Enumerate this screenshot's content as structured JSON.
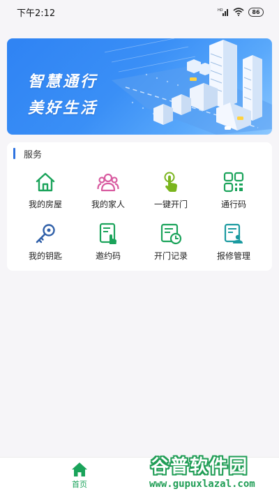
{
  "status_bar": {
    "time": "下午2:12",
    "battery": "86"
  },
  "banner": {
    "line1": "智慧通行",
    "line2": "美好生活"
  },
  "services": {
    "title": "服务",
    "items": [
      {
        "label": "我的房屋",
        "icon": "house-icon",
        "color": "#1aa35a"
      },
      {
        "label": "我的家人",
        "icon": "family-icon",
        "color": "#d85ba0"
      },
      {
        "label": "一键开门",
        "icon": "tap-icon",
        "color": "#7ab51d"
      },
      {
        "label": "通行码",
        "icon": "qr-code-icon",
        "color": "#1aa35a"
      },
      {
        "label": "我的钥匙",
        "icon": "key-icon",
        "color": "#2f5fa8"
      },
      {
        "label": "邀约码",
        "icon": "invite-code-icon",
        "color": "#1aa35a"
      },
      {
        "label": "开门记录",
        "icon": "door-record-icon",
        "color": "#1aa35a"
      },
      {
        "label": "报修管理",
        "icon": "repair-icon",
        "color": "#1a9aa0"
      }
    ]
  },
  "tabbar": {
    "home_label": "首页",
    "active_color": "#1aa35a"
  },
  "watermark": {
    "title": "谷普软件园",
    "url": "www.gupuxlazal.com"
  }
}
